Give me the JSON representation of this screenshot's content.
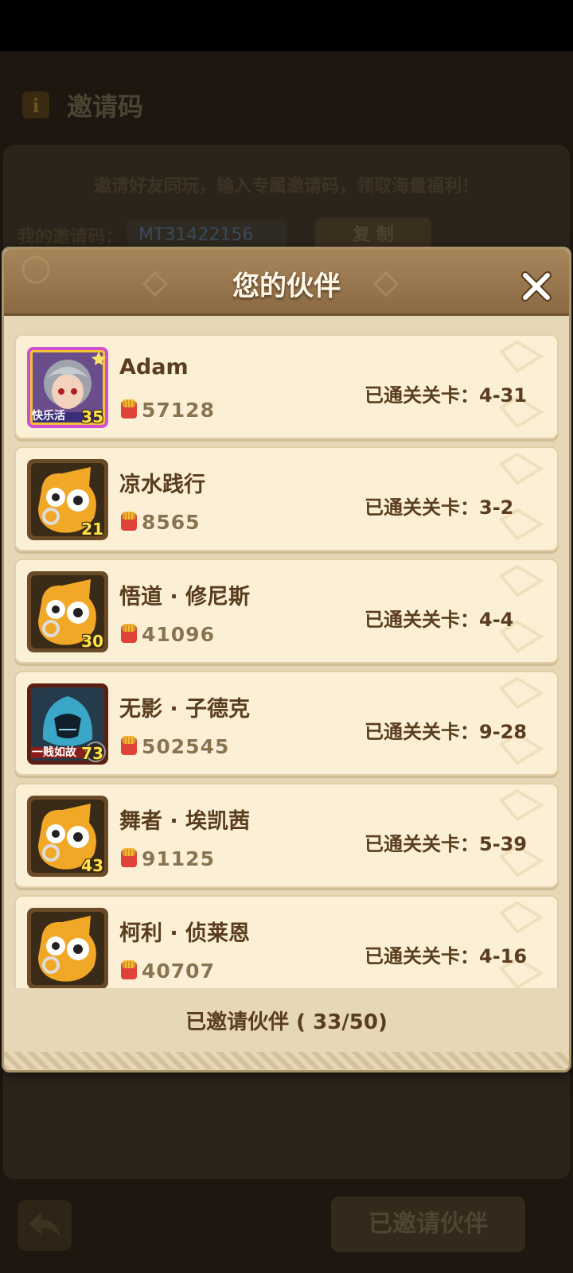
{
  "background": {
    "title": "邀请码",
    "description": "邀请好友同玩，输入专属邀请码，领取海量福利！",
    "code_label": "我的邀请码：",
    "code_value": "MT31422156",
    "copy_label": "复 制",
    "invited_button": "已邀请伙伴"
  },
  "dialog": {
    "title": "您的伙伴",
    "footer": "已邀请伙伴 ( 33/50)"
  },
  "partners": [
    {
      "name": "Adam",
      "power": "57128",
      "stage": "已通关关卡：4-31",
      "level": "35",
      "avatar": "hero-portrait",
      "tag": "快乐活"
    },
    {
      "name": "凉水践行",
      "power": "8565",
      "stage": "已通关关卡：3-2",
      "level": "21",
      "avatar": "yellow-mascot"
    },
    {
      "name": "悟道 · 修尼斯",
      "power": "41096",
      "stage": "已通关关卡：4-4",
      "level": "30",
      "avatar": "yellow-mascot"
    },
    {
      "name": "无影 · 子德克",
      "power": "502545",
      "stage": "已通关关卡：9-28",
      "level": "73",
      "avatar": "hooded-assassin",
      "tag": "一贱如故"
    },
    {
      "name": "舞者 · 埃凯茜",
      "power": "91125",
      "stage": "已通关关卡：5-39",
      "level": "43",
      "avatar": "yellow-mascot"
    },
    {
      "name": "柯利 · 侦莱恩",
      "power": "40707",
      "stage": "已通关关卡：4-16",
      "level": "",
      "avatar": "yellow-mascot"
    }
  ],
  "colors": {
    "title_brown": "#5a3d1f",
    "header_bg": "#9a7a50",
    "card_bg": "#fbf0d5"
  }
}
